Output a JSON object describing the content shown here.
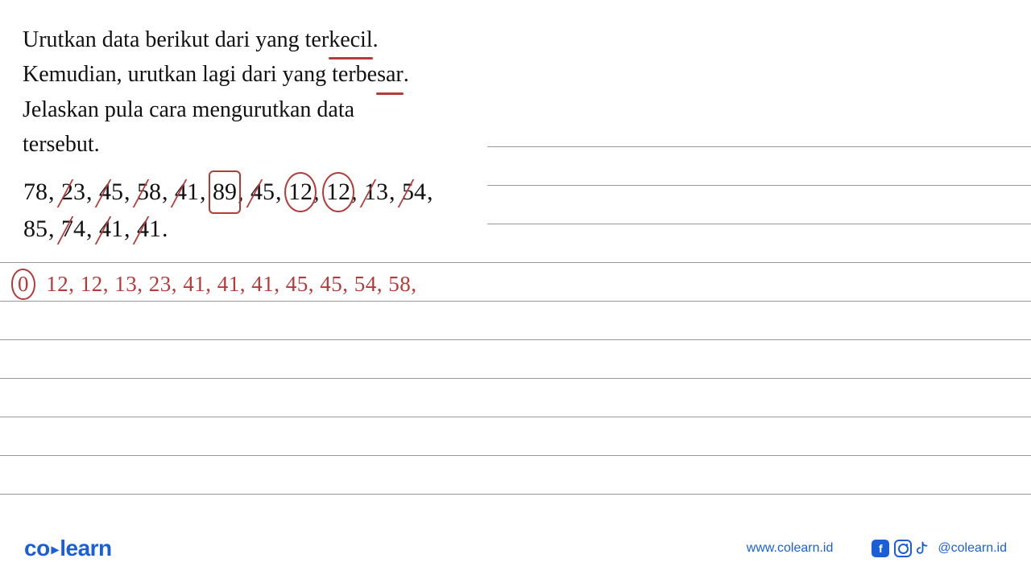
{
  "problem": {
    "line1_pre": "Urutkan data berikut dari yang ter",
    "line1_key": "kecil",
    "line1_post": ".",
    "line2_pre": "Kemudian, urutkan lagi dari yang ter",
    "line2_key": "besar",
    "line2_post": ".",
    "line3": "Jelaskan pula cara mengurutkan data",
    "line4": "tersebut."
  },
  "data_numbers": [
    {
      "val": "78",
      "mark": "none"
    },
    {
      "val": "23",
      "mark": "strike"
    },
    {
      "val": "45",
      "mark": "strike"
    },
    {
      "val": "58",
      "mark": "strike"
    },
    {
      "val": "41",
      "mark": "strike"
    },
    {
      "val": "89",
      "mark": "box"
    },
    {
      "val": "45",
      "mark": "strike"
    },
    {
      "val": "12",
      "mark": "circled"
    },
    {
      "val": "12",
      "mark": "circled"
    },
    {
      "val": "13",
      "mark": "strike"
    },
    {
      "val": "54",
      "mark": "strike"
    },
    {
      "val": "85",
      "mark": "none"
    },
    {
      "val": "74",
      "mark": "strike"
    },
    {
      "val": "41",
      "mark": "strike"
    },
    {
      "val": "41",
      "mark": "strike"
    }
  ],
  "handwriting": {
    "marker": "0",
    "answer": "12, 12, 13, 23, 41, 41, 41, 45, 45, 54, 58,"
  },
  "footer": {
    "logo_part1": "co",
    "logo_part2": "learn",
    "website": "www.colearn.id",
    "handle": "@colearn.id"
  }
}
